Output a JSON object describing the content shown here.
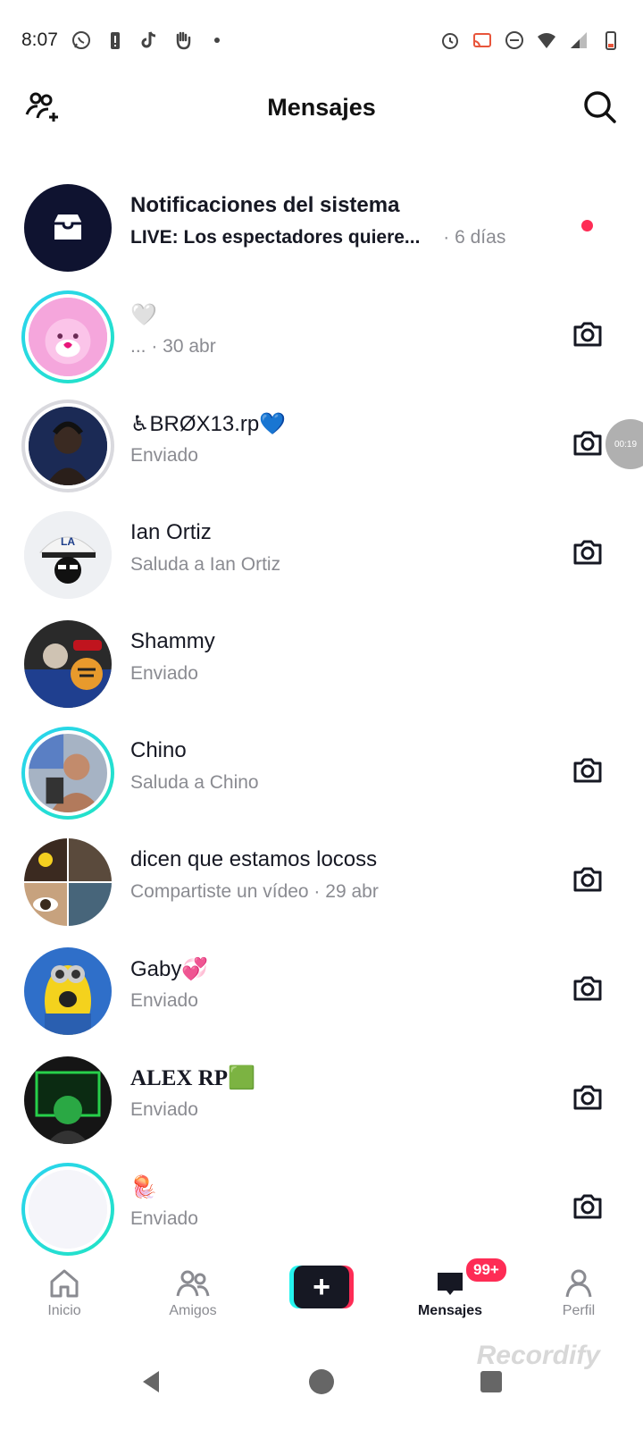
{
  "status_bar": {
    "time": "8:07",
    "left_icons": [
      "whatsapp-icon",
      "battery-alert-icon",
      "tiktok-icon",
      "hand-icon",
      "dot-icon"
    ],
    "right_icons": [
      "alarm-icon",
      "cast-icon",
      "dnd-icon",
      "wifi-icon",
      "signal-icon",
      "battery-icon"
    ]
  },
  "header": {
    "title": "Mensajes",
    "left_icon": "add-friends-icon",
    "right_icon": "search-icon"
  },
  "conversations": [
    {
      "name": "Notificaciones del sistema",
      "preview": "LIVE: Los espectadores quiere...",
      "time": "· 6 días",
      "avatar": "inbox-icon",
      "bold": true,
      "unread": true,
      "camera": false
    },
    {
      "name": "🤍",
      "preview": "... · 30 abr",
      "avatar": "pink-bear-avatar",
      "ring": "story",
      "camera": true
    },
    {
      "name": "♿BRØX13.rp💙",
      "preview": "Enviado",
      "avatar": "dark-avatar",
      "ring": "grey",
      "camera": true
    },
    {
      "name": "Ian Ortiz",
      "preview": "Saluda a Ian Ortiz",
      "avatar": "cap-avatar",
      "camera": true
    },
    {
      "name": "Shammy",
      "preview": "Enviado",
      "avatar": "tiger-avatar",
      "camera": false
    },
    {
      "name": "Chino",
      "preview": "Saluda a Chino",
      "avatar": "selfie-avatar",
      "ring": "story",
      "camera": true
    },
    {
      "name": "dicen que estamos locoss",
      "preview": "Compartiste un vídeo · 29 abr",
      "avatar": "group-avatar",
      "camera": true
    },
    {
      "name": "Gaby💞",
      "preview": "Enviado",
      "avatar": "minion-avatar",
      "camera": true
    },
    {
      "name": "ALEX RP🟩",
      "preview": "Enviado",
      "avatar": "green-avatar",
      "serif": true,
      "camera": true
    },
    {
      "name": "🪼",
      "preview": "Enviado",
      "avatar": "blank-avatar",
      "ring": "story",
      "camera": true
    }
  ],
  "floating_timer": "00:19",
  "bottom_nav": {
    "items": [
      {
        "label": "Inicio",
        "icon": "home-icon"
      },
      {
        "label": "Amigos",
        "icon": "friends-icon"
      },
      {
        "label": "",
        "icon": "plus-icon"
      },
      {
        "label": "Mensajes",
        "icon": "inbox-icon",
        "badge": "99+"
      },
      {
        "label": "Perfil",
        "icon": "profile-icon"
      }
    ]
  },
  "watermark": "Recordify",
  "colors": {
    "accent": "#fe2c55",
    "cyan": "#25f4ee",
    "text": "#161823",
    "muted": "#8a8b91"
  }
}
